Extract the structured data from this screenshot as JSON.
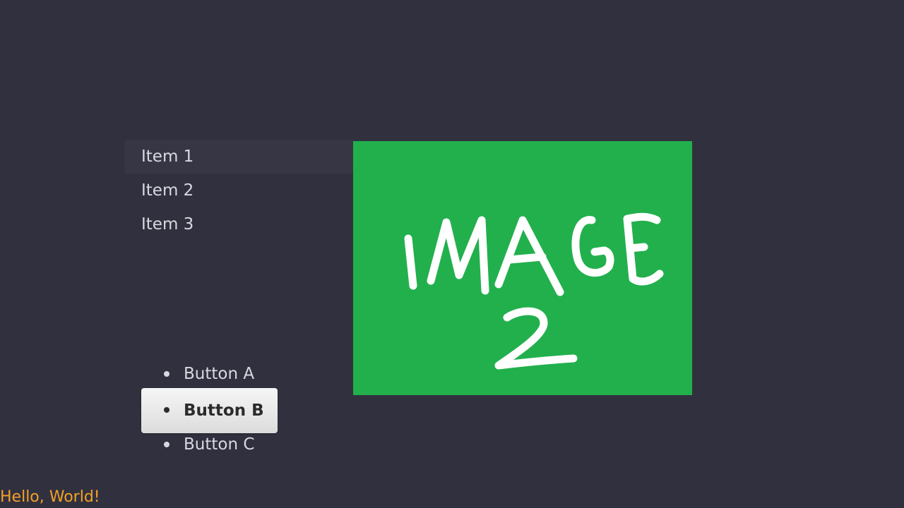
{
  "menu": {
    "items": [
      {
        "label": "Item 1"
      },
      {
        "label": "Item 2"
      },
      {
        "label": "Item 3"
      }
    ],
    "selected_index": 0
  },
  "image": {
    "text_line1": "IMAGE",
    "text_line2": "2",
    "background_color": "#22b04d"
  },
  "buttons": {
    "items": [
      {
        "label": "Button A"
      },
      {
        "label": "Button B"
      },
      {
        "label": "Button C"
      }
    ],
    "active_index": 1
  },
  "footer": {
    "text": "Hello, World!",
    "color": "#f2a127"
  }
}
